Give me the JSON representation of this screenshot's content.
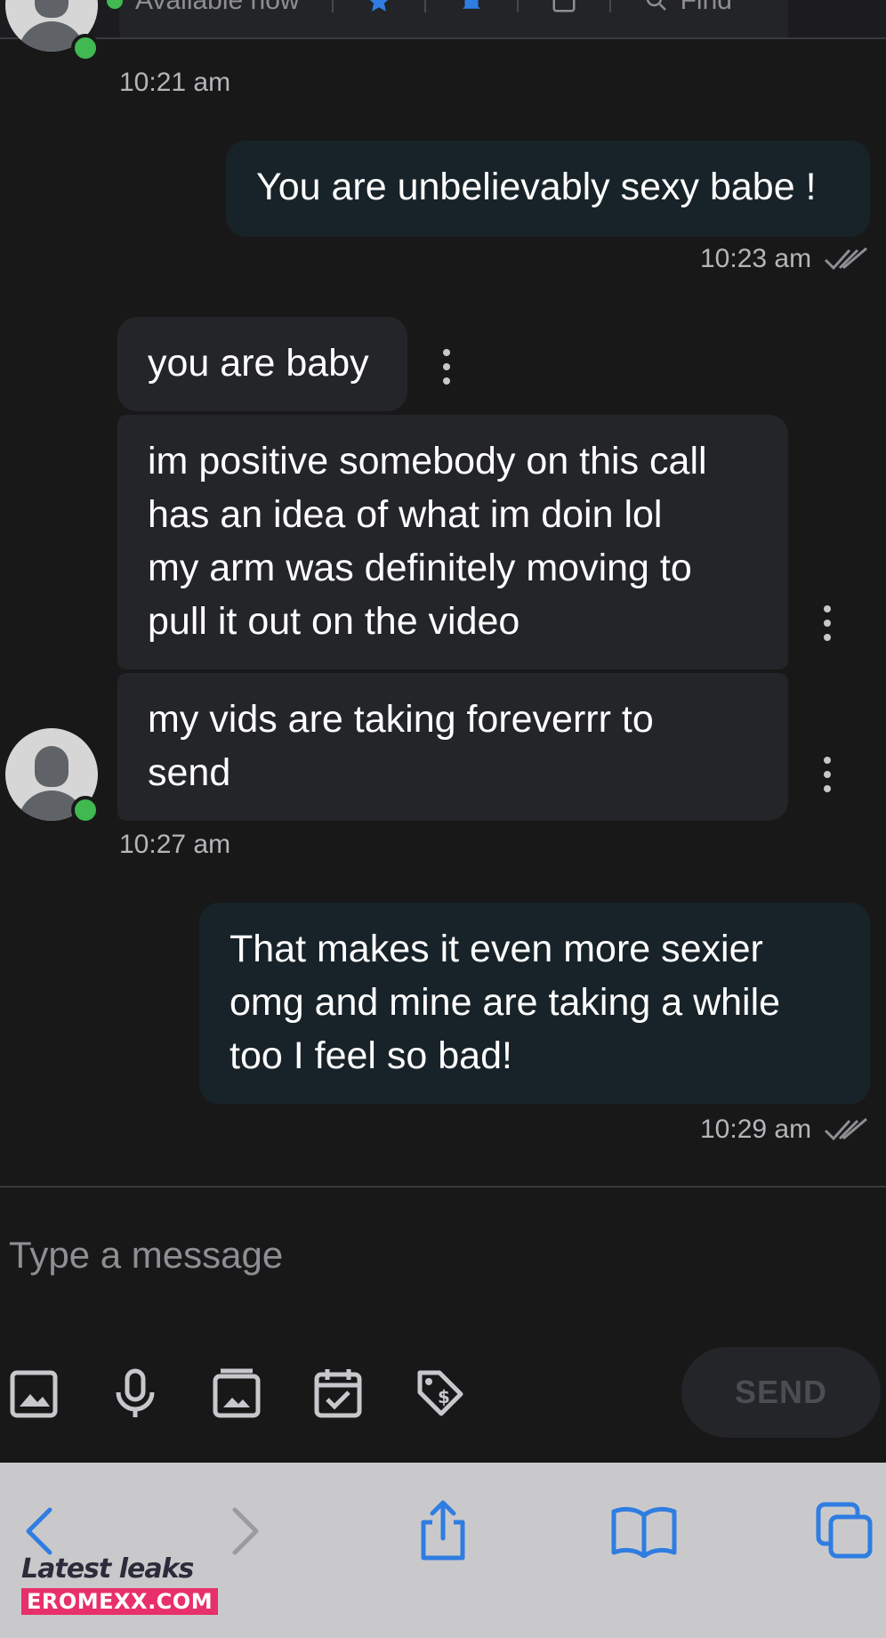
{
  "header": {
    "status_text": "Available now",
    "find_label": "Find"
  },
  "messages": [
    {
      "time": "10:21 am"
    },
    {
      "text": "You are unbelievably sexy babe !",
      "time": "10:23 am"
    },
    {
      "text": "you are baby"
    },
    {
      "text": "im positive somebody on this call\nhas an idea of what im doin lol\nmy arm was definitely moving to\npull it out on the video"
    },
    {
      "text": "my vids are taking foreverrr to\nsend",
      "time": "10:27 am"
    },
    {
      "text": "That makes it even more sexier\nomg and mine are taking a while\ntoo I feel so bad!",
      "time": "10:29 am"
    }
  ],
  "composer": {
    "placeholder": "Type a message",
    "send_label": "SEND",
    "tools": [
      "image-icon",
      "microphone-icon",
      "gallery-icon",
      "calendar-check-icon",
      "price-tag-icon"
    ]
  },
  "browser": {
    "icons": [
      "back-icon",
      "forward-icon",
      "share-icon",
      "bookmarks-icon",
      "tabs-icon"
    ],
    "accent": "#2f7de1"
  },
  "watermark": {
    "line1": "Latest leaks",
    "line2": "EROMEXX.COM"
  },
  "colors": {
    "background": "#181819",
    "incoming_bubble": "#232528",
    "outgoing_bubble": "#182329",
    "online": "#3fb950"
  }
}
